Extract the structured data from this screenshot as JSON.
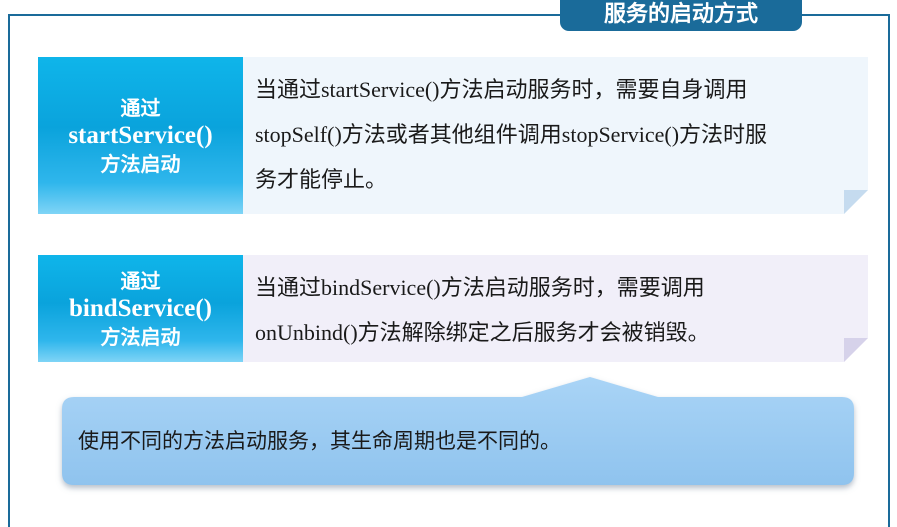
{
  "title": "服务的启动方式",
  "methods": [
    {
      "label_top": "通过",
      "label_method": "startService()",
      "label_bottom": "方法启动",
      "description_lines": [
        "当通过startService()方法启动服务时，需要自身调用",
        "stopSelf()方法或者其他组件调用stopService()方法时服",
        "务才能停止。"
      ]
    },
    {
      "label_top": "通过",
      "label_method": "bindService()",
      "label_bottom": "方法启动",
      "description_lines": [
        "当通过bindService()方法启动服务时，需要调用",
        "onUnbind()方法解除绑定之后服务才会被销毁。"
      ]
    }
  ],
  "summary": "使用不同的方法启动服务，其生命周期也是不同的。",
  "colors": {
    "frame": "#1a6b9a",
    "label_gradient_top": "#0fb5ea",
    "label_gradient_bottom": "#7fd4f6",
    "desc1_bg": "#eff6fc",
    "desc2_bg": "#f1eff9",
    "callout_bg": "#9fcdf2"
  }
}
